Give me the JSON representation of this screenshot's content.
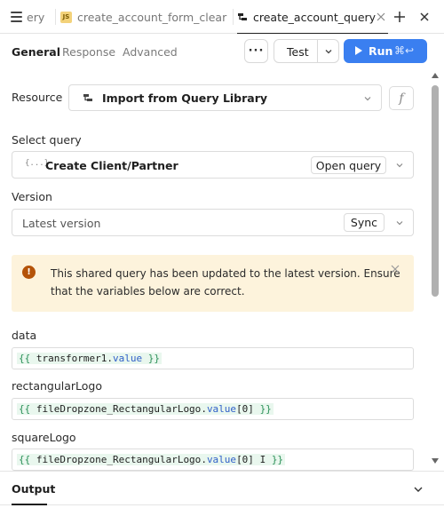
{
  "tabs": {
    "t1_label": "ery",
    "t2_label": "create_account_form_clear",
    "t2_badge": "JS",
    "t3_label": "create_account_query"
  },
  "subtabs": {
    "general": "General",
    "response": "Response",
    "advanced": "Advanced"
  },
  "toolbar": {
    "more_label": "···",
    "test_label": "Test",
    "run_label": "Run",
    "run_shortcut": "⌘↩",
    "accent_color": "#3a7ff0"
  },
  "resource": {
    "label": "Resource",
    "value": "Import from Query Library",
    "fx_label": "f"
  },
  "select_query": {
    "label": "Select query",
    "value": "Create Client/Partner",
    "icon_text": "{...}",
    "open_label": "Open query"
  },
  "version": {
    "label": "Version",
    "value": "Latest version",
    "sync_label": "Sync"
  },
  "alert": {
    "icon_text": "!",
    "message": "This shared query has been updated to the latest version. Ensure that the variables below are correct."
  },
  "variables": [
    {
      "label": "data",
      "open": "{{",
      "ident": "transformer1",
      "dot": ".",
      "prop": "value",
      "index": "",
      "cursor": "",
      "close": "}}"
    },
    {
      "label": "rectangularLogo",
      "open": "{{",
      "ident": "fileDropzone_RectangularLogo",
      "dot": ".",
      "prop": "value",
      "index": "[0]",
      "cursor": "",
      "close": "}}"
    },
    {
      "label": "squareLogo",
      "open": "{{",
      "ident": "fileDropzone_RectangularLogo",
      "dot": ".",
      "prop": "value",
      "index": "[0]",
      "cursor": "I",
      "close": "}}"
    }
  ],
  "output": {
    "title": "Output"
  }
}
